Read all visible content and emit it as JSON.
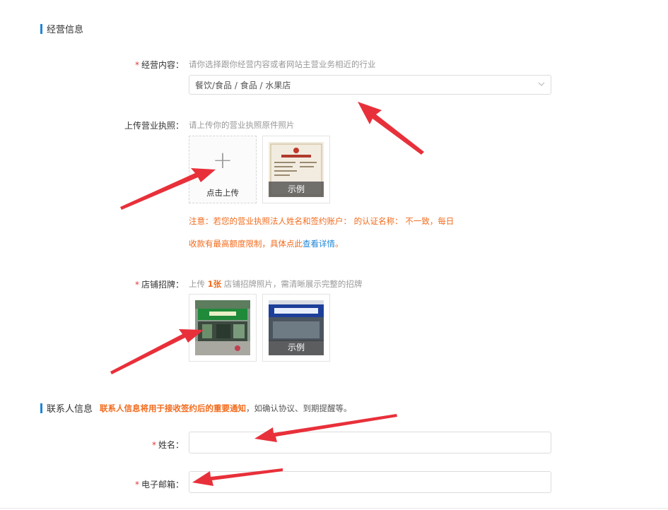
{
  "business": {
    "title": "经营信息",
    "content_label": "经营内容：",
    "content_hint": "请你选择跟你经营内容或者网站主营业务相近的行业",
    "content_value": "餐饮/食品 / 食品 / 水果店",
    "license_label": "上传营业执照：",
    "license_hint": "请上传你的营业执照原件照片",
    "upload_text": "点击上传",
    "upload_plus": "+",
    "example_label": "示例",
    "warning_line1": "注意：若您的营业执照法人姓名和签约账户：                    的认证名称：      不一致，每日",
    "warning_line2_prefix": "收款有最高额度限制，具体点此",
    "warning_link": "查看详情",
    "warning_line2_suffix": "。",
    "shop_label": "店铺招牌：",
    "shop_hint_prefix": "上传 ",
    "shop_hint_strong": "1张",
    "shop_hint_suffix": " 店铺招牌照片，需清晰展示完整的招牌",
    "shop_example_label": "示例"
  },
  "contact": {
    "title": "联系人信息",
    "note_strong": "联系人信息将用于接收签约后的重要通知",
    "note_rest": "，如确认协议、到期提醒等。",
    "name_label": "姓名：",
    "email_label": "电子邮箱：",
    "name_value": "",
    "email_value": ""
  },
  "icons": {
    "select_chevron": "chevron-down-icon",
    "required": "*"
  },
  "colors": {
    "accent_blue": "#1f86d6",
    "warning_orange": "#f26b1d",
    "required_red": "#e4393c",
    "arrow_red": "#e8303a"
  }
}
